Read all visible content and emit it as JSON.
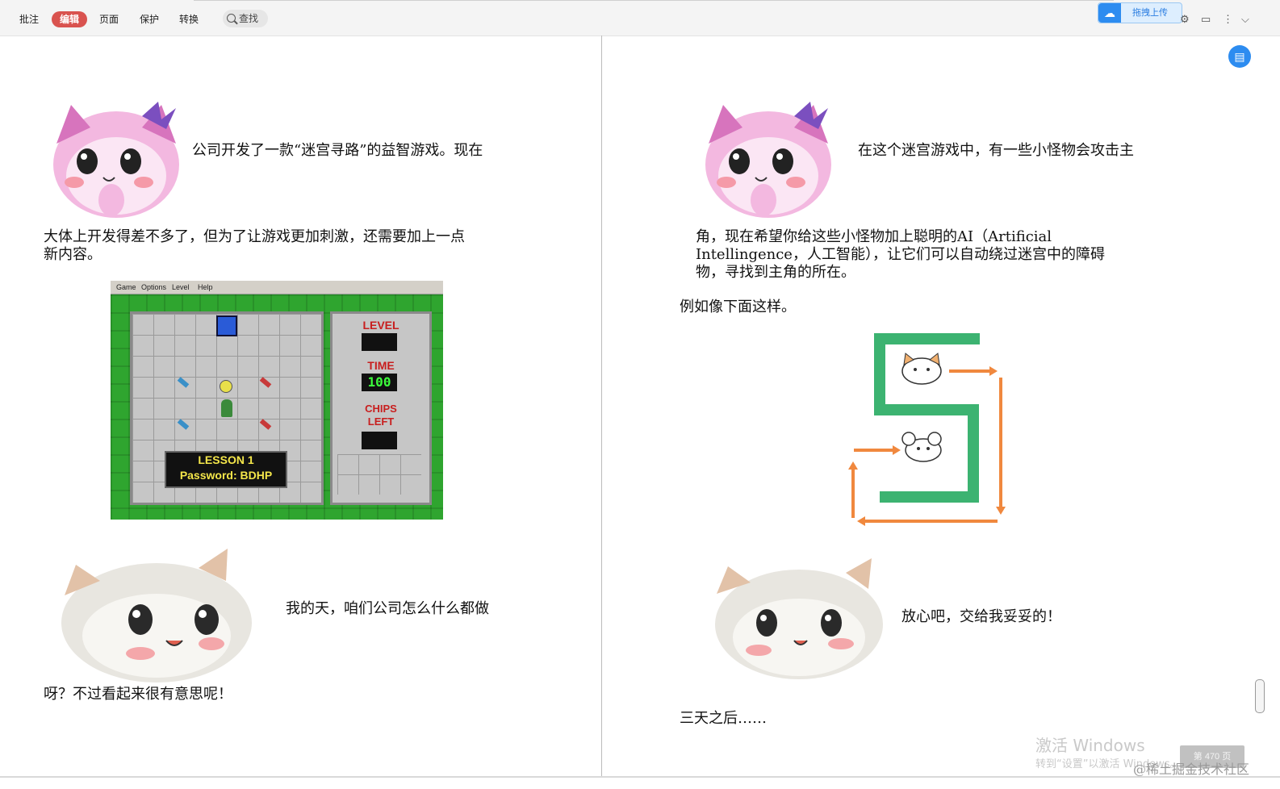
{
  "toolbar": {
    "tabs": [
      "批注",
      "编辑",
      "页面",
      "保护",
      "转换"
    ],
    "active_tab": "编辑",
    "search_label": "查找",
    "upload_label": "拖拽上传"
  },
  "page_left": {
    "para1_first_line": "公司开发了一款“迷宫寻路”的益智游戏。现在",
    "para1_line2": "大体上开发得差不多了，但为了让游戏更加刺激，还需要加上一点",
    "para1_line3": "新内容。",
    "game": {
      "menu": [
        "Game",
        "Options",
        "Level",
        "Help"
      ],
      "panel_level": "LEVEL",
      "panel_time": "TIME",
      "panel_chips": "CHIPS",
      "panel_left": "LEFT",
      "time_value": "100",
      "lesson": "LESSON 1",
      "password": "Password: BDHP"
    },
    "para2_first_line": "我的天，咱们公司怎么什么都做",
    "para2_line2": "呀？不过看起来很有意思呢！"
  },
  "page_right": {
    "para1_first_line": "在这个迷宫游戏中，有一些小怪物会攻击主",
    "para1_line2": "角，现在希望你给这些小怪物加上聪明的AI（Artificial",
    "para1_line3": "Intellingence，人工智能），让它们可以自动绕过迷宫中的障碍",
    "para1_line4": "物，寻找到主角的所在。",
    "example": "例如像下面这样。",
    "reply": "放心吧，交给我妥妥的！",
    "later": "三天之后……"
  },
  "watermark": {
    "line1": "激活 Windows",
    "line2": "转到“设置”以激活 Windows。"
  },
  "page_badge": "第 470 页",
  "corner_text": "@稀土掘金技术社区",
  "colors": {
    "accent": "#d9534f",
    "maze_green": "#3cb371",
    "path_orange": "#f0883e",
    "game_green": "#2fa52f"
  }
}
